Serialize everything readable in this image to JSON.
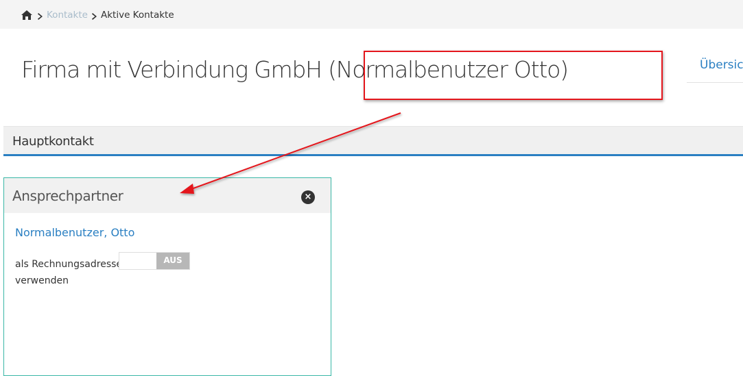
{
  "breadcrumb": {
    "home_icon": "home-icon",
    "items": [
      "Kontakte",
      "Aktive Kontakte"
    ],
    "separator_icon": "chevron-right-icon"
  },
  "page": {
    "title_main": "Firma mit Verbindung GmbH",
    "title_suffix": "(Normalbenutzer Otto)",
    "overview_link": "Übersicht"
  },
  "section": {
    "title": "Hauptkontakt"
  },
  "card": {
    "title": "Ansprechpartner",
    "close_icon": "close-icon",
    "contact_name": "Normalbenutzer, Otto",
    "use_as_billing_label": "als Rechnungsadresse verwenden",
    "toggle_state": "AUS"
  },
  "colors": {
    "accent": "#2a7fc2",
    "card_border": "#39b7a6",
    "annotation_red": "#e4161c"
  }
}
